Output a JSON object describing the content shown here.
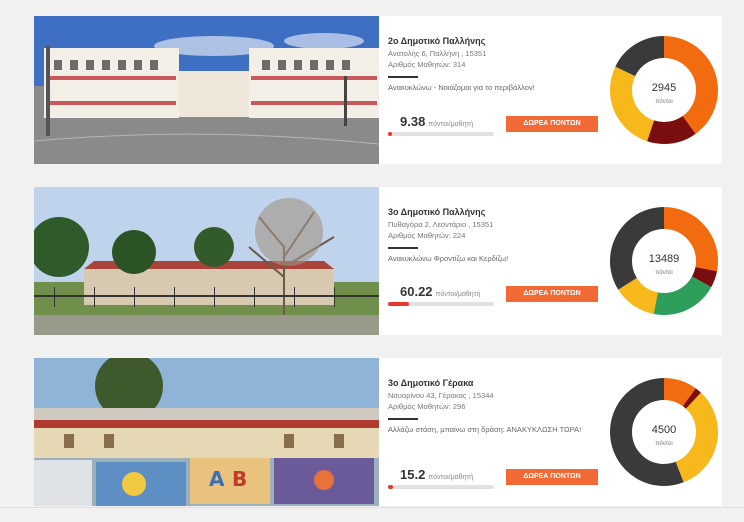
{
  "schools": [
    {
      "name": "2ο Δημοτικό Παλλήνης",
      "address": "Ανατολής 6, Παλλήνη , 15351",
      "students": "Αριθμός Μαθητών: 314",
      "slogan": "Ανακυκλώνω - Νοιάζομαι για το περιβάλλον!",
      "score": "9.38",
      "score_unit": "πόντοι/μαθητή",
      "progress": 0.04,
      "button": "ΔΩΡΕΑ ΠΟΝΤΩΝ",
      "points": "2945",
      "points_unit": "πόντοι",
      "donut": [
        {
          "value": 40,
          "color": "#f26b0f"
        },
        {
          "value": 15,
          "color": "#7a0d0d"
        },
        {
          "value": 27,
          "color": "#f6b81a"
        },
        {
          "value": 18,
          "color": "#3a3a3a"
        }
      ]
    },
    {
      "name": "3ο Δημοτικό Παλλήνης",
      "address": "Πυθαγόρα 2, Λεοντάριο , 15351",
      "students": "Αριθμός Μαθητών: 224",
      "slogan": "Ανακυκλώνω Φροντίζω και Κερδίζω!",
      "score": "60.22",
      "score_unit": "πόντοι/μαθητή",
      "progress": 0.2,
      "button": "ΔΩΡΕΑ ΠΟΝΤΩΝ",
      "points": "13489",
      "points_unit": "πόντοι",
      "donut": [
        {
          "value": 28,
          "color": "#f26b0f"
        },
        {
          "value": 5,
          "color": "#7a0d0d"
        },
        {
          "value": 20,
          "color": "#2e9e5b"
        },
        {
          "value": 13,
          "color": "#f6b81a"
        },
        {
          "value": 34,
          "color": "#3a3a3a"
        }
      ]
    },
    {
      "name": "3ο Δημοτικό Γέρακα",
      "address": "Ναυαρίνου 43, Γέρακας , 15344",
      "students": "Αριθμός Μαθητών: 296",
      "slogan": "Αλλάζω στάση, μπαίνω στη δράση: ΑΝΑΚΥΚΛΩΣΗ ΤΩΡΑ!",
      "score": "15.2",
      "score_unit": "πόντοι/μαθητή",
      "progress": 0.05,
      "button": "ΔΩΡΕΑ ΠΟΝΤΩΝ",
      "points": "4500",
      "points_unit": "πόντοι",
      "donut": [
        {
          "value": 10,
          "color": "#f26b0f"
        },
        {
          "value": 2,
          "color": "#7a0d0d"
        },
        {
          "value": 32,
          "color": "#f6b81a"
        },
        {
          "value": 56,
          "color": "#3a3a3a"
        }
      ]
    }
  ]
}
